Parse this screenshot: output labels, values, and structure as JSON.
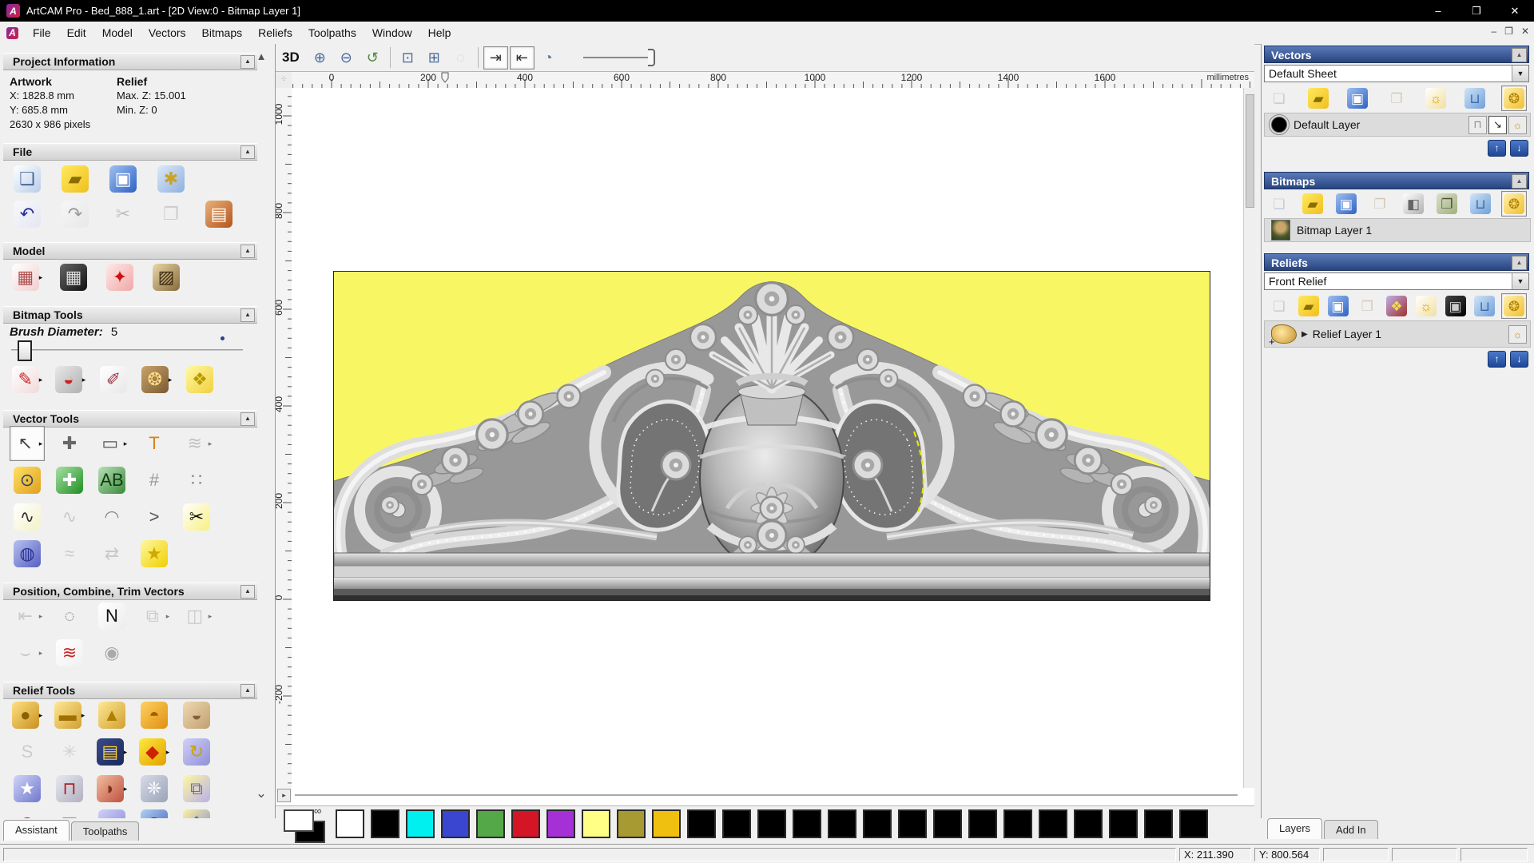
{
  "window": {
    "title": "ArtCAM Pro - Bed_888_1.art - [2D View:0 - Bitmap Layer 1]",
    "minimize": "–",
    "maximize": "❐",
    "close": "✕",
    "logo": "A"
  },
  "menu": {
    "items": [
      "File",
      "Edit",
      "Model",
      "Vectors",
      "Bitmaps",
      "Reliefs",
      "Toolpaths",
      "Window",
      "Help"
    ]
  },
  "assistant": {
    "tabs": [
      {
        "label": "Assistant",
        "active": true
      },
      {
        "label": "Toolpaths",
        "active": false
      }
    ],
    "project_information": {
      "title": "Project Information",
      "artwork_label": "Artwork",
      "x": "X: 1828.8 mm",
      "y": "Y: 685.8 mm",
      "pixels": "2630 x 986 pixels",
      "relief_label": "Relief",
      "max_z": "Max. Z: 15.001",
      "min_z": "Min. Z: 0"
    },
    "file": {
      "title": "File",
      "row1": [
        {
          "name": "new-model-icon",
          "g": "❏",
          "c": [
            "#ffffff",
            "#b9cdea"
          ],
          "fg": "#4a6a9a"
        },
        {
          "name": "open-model-icon",
          "g": "▰",
          "c": [
            "#ffe95e",
            "#f0c020"
          ],
          "fg": "#8a6d00"
        },
        {
          "name": "save-model-icon",
          "g": "▣",
          "c": [
            "#9fc0f0",
            "#2f62c4"
          ],
          "fg": "#ffffff"
        },
        {
          "name": "model-preferences-icon",
          "g": "✱",
          "c": [
            "#dce8f8",
            "#8fb0e0"
          ],
          "fg": "#caa227"
        }
      ],
      "row2": [
        {
          "name": "undo-icon",
          "g": "↶",
          "c": [
            "#f8f8fc",
            "#e6e6f2"
          ],
          "fg": "#26309c"
        },
        {
          "name": "redo-icon",
          "g": "↷",
          "c": [
            "#f6f6f6",
            "#e8e8e8"
          ],
          "fg": "#9a9a9a"
        },
        {
          "name": "cut-icon",
          "g": "✂",
          "fg": "#9a9a9a",
          "dis": true
        },
        {
          "name": "copy-icon",
          "g": "❐",
          "fg": "#b0b0b0",
          "dis": true
        },
        {
          "name": "paste-icon",
          "g": "▤",
          "c": [
            "#e8b27a",
            "#b5541c"
          ],
          "fg": "#ffffff"
        }
      ]
    },
    "model": {
      "title": "Model",
      "row1": [
        {
          "name": "set-model-size-icon",
          "g": "▦",
          "c": [
            "#ffffff",
            "#f0cfcf"
          ],
          "fg": "#b05050",
          "fly": true
        },
        {
          "name": "adjust-model-icon",
          "g": "▦",
          "c": [
            "#666666",
            "#111111"
          ],
          "fg": "#dddddd"
        },
        {
          "name": "model-lighting-icon",
          "g": "✦",
          "c": [
            "#ffe8e8",
            "#f0a8a8"
          ],
          "fg": "#cc1111"
        },
        {
          "name": "texture-from-image-icon",
          "g": "▨",
          "c": [
            "#e8d8a8",
            "#8a6a3a"
          ],
          "fg": "#3a2a10"
        }
      ]
    },
    "bitmap_tools": {
      "title": "Bitmap Tools",
      "brush_label": "Brush Diameter:",
      "brush_value": "5",
      "row1": [
        {
          "name": "paint-icon",
          "g": "✎",
          "c": [
            "#ffffff",
            "#f0dada"
          ],
          "fg": "#cc2222",
          "fly": true
        },
        {
          "name": "flood-fill-icon",
          "g": "◒",
          "c": [
            "#e8e8e8",
            "#b0b0b0"
          ],
          "fg": "#cc2222",
          "fly": true
        },
        {
          "name": "colour-picker-icon",
          "g": "✐",
          "c": [
            "#ffffff",
            "#e8e8e8"
          ],
          "fg": "#993344"
        },
        {
          "name": "colour-palette-icon",
          "g": "❂",
          "c": [
            "#caa36b",
            "#7a5a33"
          ],
          "fg": "#ffe080",
          "fly": true
        },
        {
          "name": "texture-flood-icon",
          "g": "❖",
          "c": [
            "#fff9a0",
            "#f0d040"
          ],
          "fg": "#b89a00"
        }
      ]
    },
    "vector_tools": {
      "title": "Vector Tools",
      "row1": [
        {
          "name": "select-vectors-icon",
          "g": "↖",
          "fg": "#444444",
          "pressed": true,
          "fly": true
        },
        {
          "name": "transform-vectors-icon",
          "g": "✚",
          "fg": "#666666"
        },
        {
          "name": "create-rectangle-icon",
          "g": "▭",
          "fg": "#555555",
          "fly": true
        },
        {
          "name": "create-text-icon",
          "g": "T",
          "fg": "#d9821a"
        },
        {
          "name": "envelope-distort-icon",
          "g": "≋",
          "fg": "#9a9a9a",
          "dis": true,
          "fly": true
        }
      ],
      "row2": [
        {
          "name": "measure-icon",
          "g": "⊙",
          "c": [
            "#ffe060",
            "#e0a020"
          ],
          "fg": "#334466"
        },
        {
          "name": "vector-doctor-icon",
          "g": "✚",
          "c": [
            "#a8e0a8",
            "#1f8f1f"
          ],
          "fg": "#ffffff"
        },
        {
          "name": "text-block-icon",
          "g": "AB",
          "c": [
            "#b8e0b8",
            "#3a8a3a"
          ],
          "fg": "#123a12"
        },
        {
          "name": "distort-mesh-icon",
          "g": "#",
          "fg": "#999999"
        },
        {
          "name": "block-paste-icon",
          "g": "∷",
          "fg": "#888888"
        }
      ],
      "row3": [
        {
          "name": "create-polyline-icon",
          "g": "∿",
          "c": [
            "#ffffff",
            "#f2f2c8"
          ],
          "fg": "#333333"
        },
        {
          "name": "sketch-polyline-icon",
          "g": "∿",
          "fg": "#aaaaaa",
          "dis": true
        },
        {
          "name": "create-arc-icon",
          "g": "◠",
          "fg": "#888888"
        },
        {
          "name": "fit-arcs-icon",
          "g": ">",
          "fg": "#555555"
        },
        {
          "name": "cut-vector-icon",
          "g": "✂",
          "c": [
            "#ffffff",
            "#f8f080"
          ],
          "fg": "#111111"
        }
      ],
      "row4": [
        {
          "name": "vase-tool-icon",
          "g": "◍",
          "c": [
            "#b8c0f0",
            "#5560c0"
          ],
          "fg": "#2a3090"
        },
        {
          "name": "fit-polyline-icon",
          "g": "≈",
          "fg": "#aaaaaa",
          "dis": true
        },
        {
          "name": "mirror-vectors-icon",
          "g": "⇄",
          "fg": "#aaaaaa",
          "dis": true
        },
        {
          "name": "star-tool-icon",
          "g": "★",
          "c": [
            "#fff8a0",
            "#f0d000"
          ],
          "fg": "#d0a800"
        }
      ]
    },
    "position_tools": {
      "title": "Position, Combine, Trim Vectors",
      "row1": [
        {
          "name": "align-vectors-icon",
          "g": "⇤",
          "fg": "#aaaaaa",
          "dis": true,
          "fly": true
        },
        {
          "name": "text-on-curve-icon",
          "g": "◌",
          "fg": "#777777"
        },
        {
          "name": "nesting-icon",
          "g": "N",
          "c": [
            "#ffffff",
            "#ececec"
          ],
          "fg": "#111111"
        },
        {
          "name": "group-vectors-icon",
          "g": "⧉",
          "fg": "#aaaaaa",
          "dis": true,
          "fly": true
        },
        {
          "name": "weld-vectors-icon",
          "g": "◫",
          "fg": "#aaaaaa",
          "dis": true,
          "fly": true
        }
      ],
      "row2": [
        {
          "name": "trim-vectors-icon",
          "g": "⌣",
          "fg": "#aaaaaa",
          "dis": true,
          "fly": true
        },
        {
          "name": "vector-texture-icon",
          "g": "≋",
          "c": [
            "#ffffff",
            "#f0f0f0"
          ],
          "fg": "#cc2222"
        },
        {
          "name": "spiral-icon",
          "g": "◉",
          "fg": "#aaaaaa"
        }
      ]
    },
    "relief_tools": {
      "title": "Relief Tools",
      "row1": [
        {
          "name": "load-relief-icon",
          "g": "●",
          "c": [
            "#ffe080",
            "#c89020"
          ],
          "fg": "#8a6000",
          "fly": true
        },
        {
          "name": "create-relief-block-icon",
          "g": "▬",
          "c": [
            "#ffe894",
            "#d0a030"
          ],
          "fg": "#a07000",
          "fly": true
        },
        {
          "name": "add-relief-icon",
          "g": "▲",
          "c": [
            "#ffe894",
            "#d0a030"
          ],
          "fg": "#b08000"
        },
        {
          "name": "merge-high-icon",
          "g": "◓",
          "c": [
            "#ffd060",
            "#e09010"
          ],
          "fg": "#a06000"
        },
        {
          "name": "merge-low-icon",
          "g": "◒",
          "c": [
            "#f0d8b0",
            "#c0a070"
          ],
          "fg": "#806040"
        }
      ],
      "row2": [
        {
          "name": "smooth-relief-icon",
          "g": "S",
          "fg": "#b0b0b0",
          "dis": true
        },
        {
          "name": "weave-relief-icon",
          "g": "✳",
          "fg": "#b8b8b8",
          "dis": true
        },
        {
          "name": "relief-clipart-book-icon",
          "g": "▤",
          "c": [
            "#3a4a8a",
            "#1a2a5a"
          ],
          "fg": "#ffd040",
          "fly": true
        },
        {
          "name": "zero-rest-relief-icon",
          "g": "◆",
          "c": [
            "#ffe93c",
            "#e0a000"
          ],
          "fg": "#cc2200",
          "fly": true
        },
        {
          "name": "relief-envelope-icon",
          "g": "↻",
          "c": [
            "#d0d0f8",
            "#9090d8"
          ],
          "fg": "#caa200"
        }
      ],
      "row3": [
        {
          "name": "create-shape-star-icon",
          "g": "★",
          "c": [
            "#d0d4f8",
            "#7078cc"
          ],
          "fg": "#ffffff"
        },
        {
          "name": "press-mold-icon",
          "g": "⊓",
          "c": [
            "#e8e8f0",
            "#b0b0c0"
          ],
          "fg": "#aa2222"
        },
        {
          "name": "fade-relief-icon",
          "g": "◗",
          "c": [
            "#f0c0a0",
            "#c05040"
          ],
          "fg": "#803020",
          "fly": true
        },
        {
          "name": "sculpt-relief-icon",
          "g": "❈",
          "c": [
            "#d8dce8",
            "#9aa2b8"
          ],
          "fg": "#ffffff"
        },
        {
          "name": "offset-relief-icon",
          "g": "⧉",
          "c": [
            "#fff8a0",
            "#b8b0e8"
          ],
          "fg": "#7068b0"
        }
      ],
      "row4": [
        {
          "name": "dome-red-icon",
          "g": "◠",
          "fg": "#cc2222"
        },
        {
          "name": "wireframe-basket-icon",
          "g": "▦",
          "fg": "#999999"
        },
        {
          "name": "dome-purple-icon",
          "g": "◓",
          "c": [
            "#d0d0f8",
            "#8888d8"
          ],
          "fg": "#6060b0"
        },
        {
          "name": "texture-sphere-icon",
          "g": "◍",
          "c": [
            "#b0d0f0",
            "#4060c0"
          ],
          "fg": "#204080"
        },
        {
          "name": "angled-plane-icon",
          "g": "❖",
          "c": [
            "#fff0a0",
            "#8090d0"
          ],
          "fg": "#6070b0"
        }
      ]
    }
  },
  "view": {
    "toolbar": {
      "mode_3d": "3D",
      "buttons": [
        {
          "name": "zoom-in-icon",
          "g": "⊕",
          "fg": "#4a6a9a"
        },
        {
          "name": "zoom-out-icon",
          "g": "⊖",
          "fg": "#4a6a9a"
        },
        {
          "name": "zoom-previous-icon",
          "g": "↺",
          "fg": "#4a8a3a"
        },
        {
          "sep": true
        },
        {
          "name": "zoom-box-icon",
          "g": "⊡",
          "fg": "#4a6a9a"
        },
        {
          "name": "zoom-fit-icon",
          "g": "⊞",
          "fg": "#4a6a9a"
        },
        {
          "name": "zoom-selected-icon",
          "g": "◌",
          "fg": "#b0b0b0",
          "dis": true
        },
        {
          "sep": true
        },
        {
          "name": "toggle-bitmap-visibility-icon",
          "g": "⇥",
          "fg": "#333333",
          "pressed": true
        },
        {
          "name": "toggle-vector-visibility-icon",
          "g": "⇤",
          "fg": "#333333",
          "pressed": true
        },
        {
          "name": "preview-relief-icon",
          "g": "◔",
          "fg": "#5a7a9a"
        }
      ]
    },
    "hruler": {
      "unit": "millimetres",
      "labels": [
        0,
        200,
        400,
        600,
        800,
        1000,
        1200,
        1400,
        1600
      ]
    },
    "vruler": {
      "labels": [
        1000,
        800,
        600,
        400,
        200,
        0,
        -200
      ]
    }
  },
  "layers_panel": {
    "vectors": {
      "title": "Vectors",
      "sheet": "Default Sheet",
      "toolbar": [
        {
          "name": "new-vector-layer-icon",
          "g": "❏",
          "fg": "#9ab0cc",
          "dis": true
        },
        {
          "name": "open-vector-layer-icon",
          "g": "▰",
          "c": [
            "#ffe95e",
            "#f0c020"
          ],
          "fg": "#8a6d00"
        },
        {
          "name": "save-vector-layer-icon",
          "g": "▣",
          "c": [
            "#9fc0f0",
            "#2f62c4"
          ],
          "fg": "#ffffff"
        },
        {
          "name": "merge-vector-layers-icon",
          "g": "❐",
          "fg": "#c0a888",
          "dis": true
        },
        {
          "name": "toggle-layer-visibility-icon",
          "g": "☼",
          "c": [
            "#ffffff",
            "#f0e0a0"
          ],
          "fg": "#e0a000"
        },
        {
          "name": "delete-vector-layer-icon",
          "g": "⊔",
          "c": [
            "#d0e4f8",
            "#70a0d8"
          ],
          "fg": "#3a6aaa"
        },
        {
          "name": "all-layers-on-icon",
          "g": "❂",
          "c": [
            "#fff0b0",
            "#f0c030"
          ],
          "fg": "#b08000",
          "pressed": true
        }
      ],
      "layer": {
        "name": "Default Layer"
      },
      "layer_buttons": [
        {
          "name": "layer-lock-icon",
          "g": "⊓",
          "fg": "#888888"
        },
        {
          "name": "layer-snap-icon",
          "g": "↘",
          "fg": "#222222",
          "pressed": true
        },
        {
          "name": "layer-visibility-icon",
          "g": "☼",
          "fg": "#d09000"
        }
      ]
    },
    "bitmaps": {
      "title": "Bitmaps",
      "toolbar": [
        {
          "name": "new-bitmap-layer-icon",
          "g": "❏",
          "fg": "#9ab0cc",
          "dis": true
        },
        {
          "name": "open-bitmap-layer-icon",
          "g": "▰",
          "c": [
            "#ffe95e",
            "#f0c020"
          ],
          "fg": "#8a6d00"
        },
        {
          "name": "save-bitmap-layer-icon",
          "g": "▣",
          "c": [
            "#9fc0f0",
            "#2f62c4"
          ],
          "fg": "#ffffff"
        },
        {
          "name": "merge-bitmap-layers-icon",
          "g": "❐",
          "fg": "#c0a888",
          "dis": true
        },
        {
          "name": "greyscale-icon",
          "g": "◧",
          "c": [
            "#ffffff",
            "#b0b0b0"
          ],
          "fg": "#666666"
        },
        {
          "name": "copy-bitmap-layer-icon",
          "g": "❐",
          "c": [
            "#d8e0c8",
            "#a0b080"
          ],
          "fg": "#5a4a3a"
        },
        {
          "name": "delete-bitmap-layer-icon",
          "g": "⊔",
          "c": [
            "#d0e4f8",
            "#70a0d8"
          ],
          "fg": "#3a6aaa"
        },
        {
          "name": "all-bitmaps-on-icon",
          "g": "❂",
          "c": [
            "#fff0b0",
            "#f0c030"
          ],
          "fg": "#b08000",
          "pressed": true
        }
      ],
      "layer": {
        "name": "Bitmap Layer 1"
      }
    },
    "reliefs": {
      "title": "Reliefs",
      "sheet": "Front Relief",
      "toolbar": [
        {
          "name": "new-relief-layer-icon",
          "g": "❏",
          "fg": "#9ab0cc",
          "dis": true
        },
        {
          "name": "open-relief-layer-icon",
          "g": "▰",
          "c": [
            "#ffe95e",
            "#f0c020"
          ],
          "fg": "#8a6d00"
        },
        {
          "name": "save-relief-layer-icon",
          "g": "▣",
          "c": [
            "#9fc0f0",
            "#2f62c4"
          ],
          "fg": "#ffffff"
        },
        {
          "name": "merge-relief-layers-icon",
          "g": "❐",
          "fg": "#c0a888",
          "dis": true
        },
        {
          "name": "stack-reliefs-icon",
          "g": "❖",
          "c": [
            "#c0b0e8",
            "#a03030"
          ],
          "fg": "#f0e040"
        },
        {
          "name": "toggle-relief-visibility-icon",
          "g": "☼",
          "c": [
            "#ffffff",
            "#f0e0a0"
          ],
          "fg": "#e0a000"
        },
        {
          "name": "relief-greyscale-icon",
          "g": "▣",
          "c": [
            "#444444",
            "#000000"
          ],
          "fg": "#cccccc"
        },
        {
          "name": "delete-relief-layer-icon",
          "g": "⊔",
          "c": [
            "#d0e4f8",
            "#70a0d8"
          ],
          "fg": "#3a6aaa"
        },
        {
          "name": "all-reliefs-on-icon",
          "g": "❂",
          "c": [
            "#fff0b0",
            "#f0c030"
          ],
          "fg": "#b08000",
          "pressed": true
        }
      ],
      "layer": {
        "name": "Relief Layer 1"
      },
      "layer_buttons": [
        {
          "name": "relief-visibility-icon",
          "g": "☼",
          "fg": "#d09000"
        }
      ]
    },
    "tabs": [
      {
        "label": "Layers",
        "active": true
      },
      {
        "label": "Add In",
        "active": false
      }
    ]
  },
  "palette": {
    "primary": "#ffffff",
    "secondary": "#000000",
    "colors": [
      "#ffffff",
      "#000000",
      "#00f0f0",
      "#3a45d0",
      "#55a848",
      "#d41525",
      "#a531d6",
      "#ffff86",
      "#a89a32",
      "#f0c011",
      "#000000",
      "#000000",
      "#000000",
      "#000000",
      "#000000",
      "#000000",
      "#000000",
      "#000000",
      "#000000",
      "#000000",
      "#000000",
      "#000000",
      "#000000",
      "#000000",
      "#000000"
    ]
  },
  "status": {
    "x": "X: 211.390",
    "y": "Y: 800.564"
  }
}
